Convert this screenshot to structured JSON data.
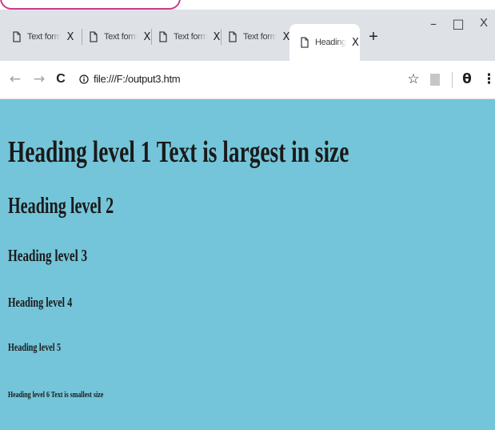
{
  "tabs": [
    {
      "label": "Text formatting",
      "close": "X"
    },
    {
      "label": "Text formatting",
      "close": "X"
    },
    {
      "label": "Text formatting",
      "close": "X"
    },
    {
      "label": "Text formatting",
      "close": "X"
    },
    {
      "label": "Heading",
      "close": "X",
      "active": true
    }
  ],
  "new_tab": "+",
  "window_controls": {
    "minimize": "–",
    "maximize": "□",
    "close": "X"
  },
  "nav": {
    "back": "←",
    "forward": "→",
    "reload": "C"
  },
  "address": {
    "url": "file:///F:/output3.htm"
  },
  "toolbar_icons": {
    "bookmark": "☆",
    "profile": "θ",
    "menu": "⋮"
  },
  "headings": {
    "h1": "Heading level 1 Text is largest in size",
    "h2": "Heading level 2",
    "h3": "Heading level 3",
    "h4": "Heading level 4",
    "h5": "Heading level 5",
    "h6": "Heading level 6 Text is smallest size"
  },
  "colors": {
    "page_background": "#74c5d9",
    "tabstrip": "#dee1e6",
    "callout_border": "#c83c8c"
  }
}
